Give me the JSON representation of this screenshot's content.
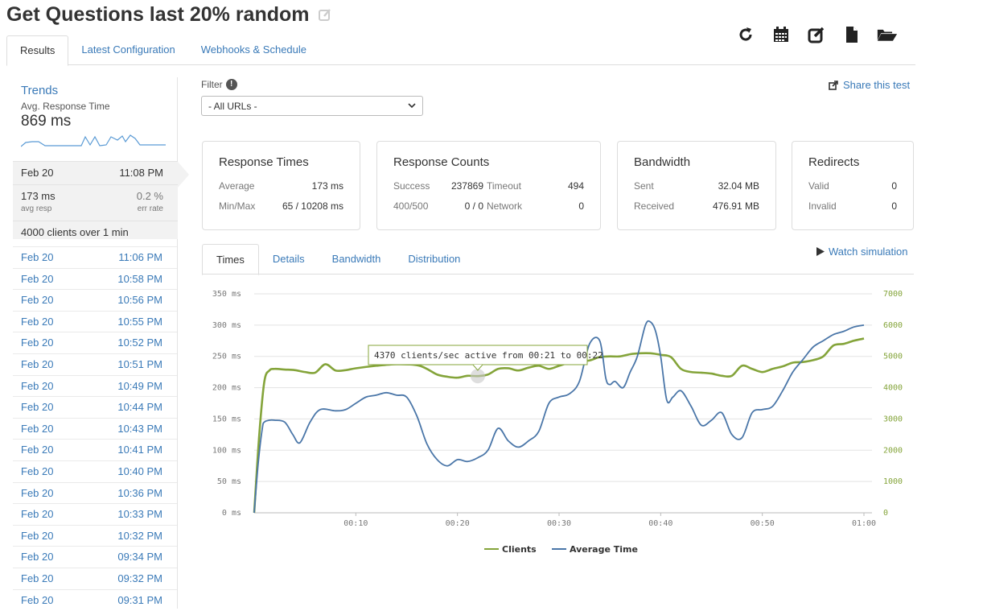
{
  "page": {
    "title": "Get Questions last 20% random"
  },
  "toolbar": {
    "icons": [
      "refresh-icon",
      "calendar-icon",
      "edit-icon",
      "file-icon",
      "folder-open-icon"
    ]
  },
  "tabs": [
    {
      "label": "Results",
      "active": true
    },
    {
      "label": "Latest Configuration",
      "active": false
    },
    {
      "label": "Webhooks & Schedule",
      "active": false
    }
  ],
  "sidebar": {
    "trends": {
      "title": "Trends",
      "subtitle": "Avg. Response Time",
      "value": "869 ms"
    },
    "current": {
      "date": "Feb 20",
      "time": "11:08 PM",
      "avg_resp": "173 ms",
      "avg_resp_label": "avg resp",
      "err_rate": "0.2 %",
      "err_rate_label": "err rate",
      "clients_count": "4000",
      "clients_text": "clients over",
      "duration": "1 min"
    },
    "history": [
      {
        "date": "Feb 20",
        "time": "11:06 PM"
      },
      {
        "date": "Feb 20",
        "time": "10:58 PM"
      },
      {
        "date": "Feb 20",
        "time": "10:56 PM"
      },
      {
        "date": "Feb 20",
        "time": "10:55 PM"
      },
      {
        "date": "Feb 20",
        "time": "10:52 PM"
      },
      {
        "date": "Feb 20",
        "time": "10:51 PM"
      },
      {
        "date": "Feb 20",
        "time": "10:49 PM"
      },
      {
        "date": "Feb 20",
        "time": "10:44 PM"
      },
      {
        "date": "Feb 20",
        "time": "10:43 PM"
      },
      {
        "date": "Feb 20",
        "time": "10:41 PM"
      },
      {
        "date": "Feb 20",
        "time": "10:40 PM"
      },
      {
        "date": "Feb 20",
        "time": "10:36 PM"
      },
      {
        "date": "Feb 20",
        "time": "10:33 PM"
      },
      {
        "date": "Feb 20",
        "time": "10:32 PM"
      },
      {
        "date": "Feb 20",
        "time": "09:34 PM"
      },
      {
        "date": "Feb 20",
        "time": "09:32 PM"
      },
      {
        "date": "Feb 20",
        "time": "09:31 PM"
      }
    ]
  },
  "filter": {
    "label": "Filter",
    "selected": "- All URLs -"
  },
  "share": {
    "label": "Share this test"
  },
  "cards": {
    "response_times": {
      "title": "Response Times",
      "average_label": "Average",
      "average": "173 ms",
      "minmax_label": "Min/Max",
      "minmax": "65 / 10208 ms"
    },
    "response_counts": {
      "title": "Response Counts",
      "success_label": "Success",
      "success": "237869",
      "timeout_label": "Timeout",
      "timeout": "494",
      "err_label": "400/500",
      "err": "0 / 0",
      "network_label": "Network",
      "network": "0"
    },
    "bandwidth": {
      "title": "Bandwidth",
      "sent_label": "Sent",
      "sent": "32.04 MB",
      "received_label": "Received",
      "received": "476.91 MB"
    },
    "redirects": {
      "title": "Redirects",
      "valid_label": "Valid",
      "valid": "0",
      "invalid_label": "Invalid",
      "invalid": "0"
    }
  },
  "subtabs": [
    {
      "label": "Times",
      "active": true
    },
    {
      "label": "Details",
      "active": false
    },
    {
      "label": "Bandwidth",
      "active": false
    },
    {
      "label": "Distribution",
      "active": false
    }
  ],
  "watch": {
    "label": "Watch simulation"
  },
  "colors": {
    "clients": "#84a43a",
    "average_time": "#4a76a8",
    "link": "#3a7ab8"
  },
  "chart_data": {
    "type": "line",
    "x_ticks": [
      "00:10",
      "00:20",
      "00:30",
      "00:40",
      "00:50",
      "01:00"
    ],
    "y_left_ticks": [
      "0 ms",
      "50 ms",
      "100 ms",
      "150 ms",
      "200 ms",
      "250 ms",
      "300 ms",
      "350 ms"
    ],
    "y_left_range": [
      0,
      350
    ],
    "y_right_ticks": [
      "0",
      "1000",
      "2000",
      "3000",
      "4000",
      "5000",
      "6000",
      "7000"
    ],
    "y_right_range": [
      0,
      7000
    ],
    "x_range_seconds": [
      0,
      60
    ],
    "grid": true,
    "legend_position": "bottom",
    "tooltip": "4370 clients/sec active from 00:21 to 00:22",
    "tooltip_x": 22,
    "series": [
      {
        "name": "Clients",
        "axis": "right",
        "x": [
          0,
          0.5,
          1,
          1.5,
          2,
          3,
          4,
          5,
          6,
          7,
          8,
          9,
          10,
          12,
          14,
          16,
          17,
          18,
          19,
          20,
          21,
          22,
          23,
          24,
          25,
          26,
          27,
          28,
          29,
          30,
          31,
          32,
          33,
          34,
          35,
          36,
          37,
          38,
          39,
          40,
          41,
          42,
          43,
          44,
          45,
          46,
          47,
          48,
          49,
          50,
          51,
          52,
          53,
          54,
          55,
          56,
          57,
          58,
          59,
          60
        ],
        "y": [
          0,
          2500,
          4200,
          4550,
          4600,
          4580,
          4560,
          4500,
          4480,
          4750,
          4550,
          4560,
          4620,
          4700,
          4750,
          4720,
          4600,
          4420,
          4350,
          4320,
          4380,
          4370,
          4420,
          4600,
          4620,
          4550,
          4640,
          4700,
          4600,
          4700,
          4800,
          4850,
          4870,
          4980,
          5000,
          5000,
          5070,
          5100,
          5100,
          5050,
          4980,
          4600,
          4500,
          4480,
          4450,
          4380,
          4380,
          4700,
          4600,
          4500,
          4600,
          4680,
          4800,
          4820,
          4880,
          5000,
          5350,
          5400,
          5500,
          5570
        ]
      },
      {
        "name": "Average Time",
        "axis": "left",
        "x": [
          0,
          0.4,
          0.8,
          1,
          1.5,
          2,
          3,
          3.8,
          4.5,
          5.5,
          6.5,
          8,
          9,
          10,
          11,
          12,
          13,
          14,
          15,
          16,
          17,
          18,
          19,
          20,
          21,
          22,
          23,
          24,
          25,
          26,
          27,
          28,
          29,
          30,
          31,
          32,
          33,
          34,
          34.6,
          35,
          35.5,
          36.3,
          37,
          37.7,
          38.5,
          39,
          39.5,
          40,
          40.6,
          41.2,
          42,
          43,
          44,
          45,
          46,
          47,
          48,
          49,
          50,
          51,
          52,
          53,
          54,
          55,
          56,
          57,
          58,
          59,
          60
        ],
        "y": [
          0,
          80,
          135,
          145,
          148,
          148,
          145,
          125,
          112,
          145,
          165,
          163,
          165,
          175,
          185,
          188,
          192,
          188,
          185,
          155,
          110,
          85,
          75,
          85,
          82,
          88,
          100,
          135,
          115,
          105,
          115,
          130,
          175,
          185,
          190,
          210,
          270,
          275,
          215,
          205,
          210,
          200,
          225,
          250,
          300,
          305,
          290,
          250,
          180,
          185,
          195,
          170,
          140,
          148,
          160,
          125,
          120,
          160,
          165,
          170,
          195,
          225,
          245,
          265,
          275,
          285,
          290,
          297,
          300
        ]
      }
    ]
  }
}
